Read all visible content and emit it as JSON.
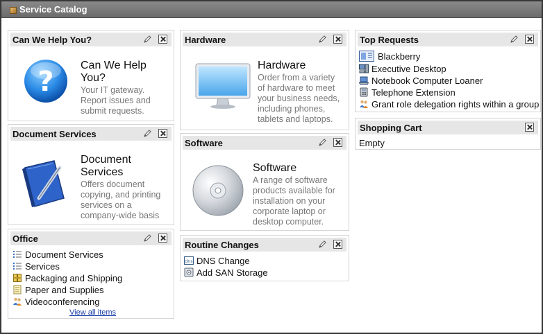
{
  "app": {
    "title": "Service Catalog"
  },
  "widgets": {
    "help": {
      "title": "Can We Help You?",
      "name": "Can We Help You?",
      "desc_lines": [
        "Your IT gateway.",
        "Report issues and",
        "submit requests."
      ]
    },
    "docs": {
      "title": "Document Services",
      "name_lines": [
        "Document",
        "Services"
      ],
      "desc_lines": [
        "Offers document",
        "copying, and printing",
        "services on a",
        "company-wide basis"
      ]
    },
    "office": {
      "title": "Office",
      "items": [
        {
          "label": "Document Services",
          "icon": "list-icon"
        },
        {
          "label": "Services",
          "icon": "list-icon"
        },
        {
          "label": "Packaging and Shipping",
          "icon": "package-icon"
        },
        {
          "label": "Paper and Supplies",
          "icon": "paper-icon"
        },
        {
          "label": "Videoconferencing",
          "icon": "people-icon"
        }
      ],
      "view_all": "View all items"
    },
    "hardware": {
      "title": "Hardware",
      "name": "Hardware",
      "desc_lines": [
        "Order from a variety",
        "of hardware to meet",
        "your business needs,",
        "including phones,",
        "tablets and laptops."
      ]
    },
    "software": {
      "title": "Software",
      "name": "Software",
      "desc_lines": [
        "A range of software",
        "products available for",
        "installation on your",
        "corporate laptop or",
        "desktop computer."
      ]
    },
    "routine": {
      "title": "Routine Changes",
      "items": [
        {
          "label": "DNS Change",
          "icon": "dns-icon"
        },
        {
          "label": "Add SAN Storage",
          "icon": "storage-icon"
        }
      ]
    },
    "top": {
      "title": "Top Requests",
      "items": [
        {
          "label": "Blackberry",
          "icon": "blackberry-icon"
        },
        {
          "label": "Executive Desktop",
          "icon": "desktop-icon"
        },
        {
          "label": "Notebook Computer Loaner",
          "icon": "laptop-icon"
        },
        {
          "label": "Telephone Extension",
          "icon": "telephone-icon"
        },
        {
          "label": "Grant role delegation rights within a group",
          "icon": "people-icon"
        }
      ]
    },
    "cart": {
      "title": "Shopping Cart",
      "status": "Empty"
    }
  }
}
